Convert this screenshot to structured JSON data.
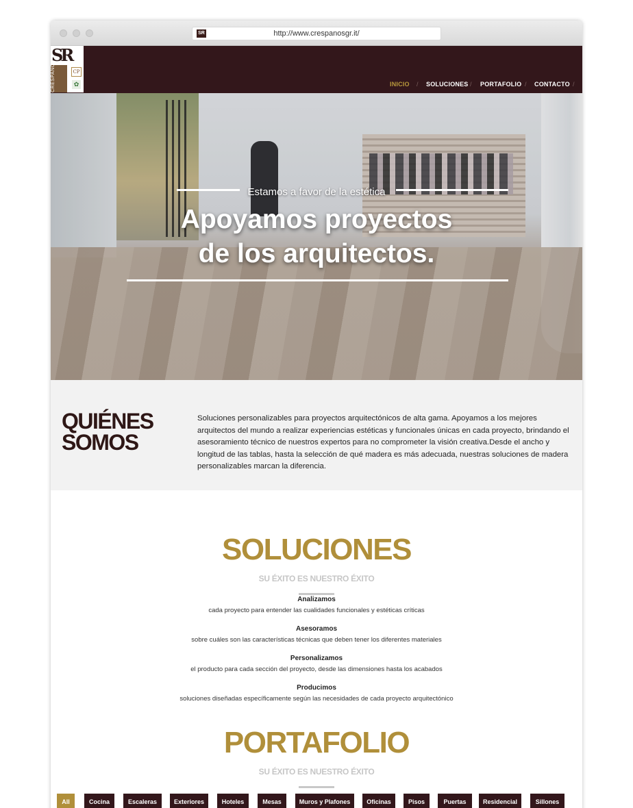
{
  "browser": {
    "url": "http://www.crespanosgr.it/",
    "favicon_text": "SR"
  },
  "logo": {
    "top_text": "SR",
    "side_text": "CRESPANO",
    "badge_text": "CP"
  },
  "nav": {
    "items": [
      {
        "label": "INICIO",
        "active": true
      },
      {
        "label": "SOLUCIONES",
        "active": false
      },
      {
        "label": "PORTAFOLIO",
        "active": false
      },
      {
        "label": "CONTACTO",
        "active": false
      }
    ],
    "separator": "/"
  },
  "hero": {
    "subtitle": "Estamos a favor de la estética",
    "title_line1": "Apoyamos proyectos",
    "title_line2": "de los arquitectos."
  },
  "about": {
    "heading_line1": "QUIÉNES",
    "heading_line2": "SOMOS",
    "text": "Soluciones personalizables para proyectos arquitectónicos de alta gama. Apoyamos a los mejores arquitectos del mundo a realizar experiencias estéticas y funcionales únicas en cada proyecto, brindando el asesoramiento técnico de nuestros expertos para no comprometer la visión creativa.Desde el ancho y longitud de las tablas, hasta la selección de qué madera es más adecuada, nuestras soluciones de madera personalizables marcan la diferencia."
  },
  "soluciones": {
    "title": "SOLUCIONES",
    "subtitle": "SU ÉXITO ES NUESTRO ÉXITO",
    "features": [
      {
        "title": "Analizamos",
        "desc": "cada proyecto para entender las cualidades funcionales y estéticas críticas"
      },
      {
        "title": "Asesoramos",
        "desc": "sobre cuáles son las características técnicas que deben tener los diferentes materiales"
      },
      {
        "title": "Personalizamos",
        "desc": "el producto para cada sección del proyecto, desde las dimensiones hasta los acabados"
      },
      {
        "title": "Producimos",
        "desc": "soluciones diseñadas específicamente según las necesidades de cada proyecto arquitectónico"
      }
    ]
  },
  "portafolio": {
    "title": "PORTAFOLIO",
    "subtitle": "SU ÉXITO ES NUESTRO ÉXITO",
    "filters": [
      {
        "label": "All",
        "active": true
      },
      {
        "label": "Cocina",
        "active": false
      },
      {
        "label": "Escaleras",
        "active": false
      },
      {
        "label": "Exteriores",
        "active": false
      },
      {
        "label": "Hoteles",
        "active": false
      },
      {
        "label": "Mesas",
        "active": false
      },
      {
        "label": "Muros y Plafones",
        "active": false
      },
      {
        "label": "Oficinas",
        "active": false
      },
      {
        "label": "Pisos",
        "active": false
      },
      {
        "label": "Puertas",
        "active": false
      },
      {
        "label": "Residencial",
        "active": false
      },
      {
        "label": "Sillones",
        "active": false
      }
    ]
  },
  "colors": {
    "brand_dark": "#33171b",
    "accent_gold": "#b08f3a",
    "nav_active": "#b8993c"
  }
}
